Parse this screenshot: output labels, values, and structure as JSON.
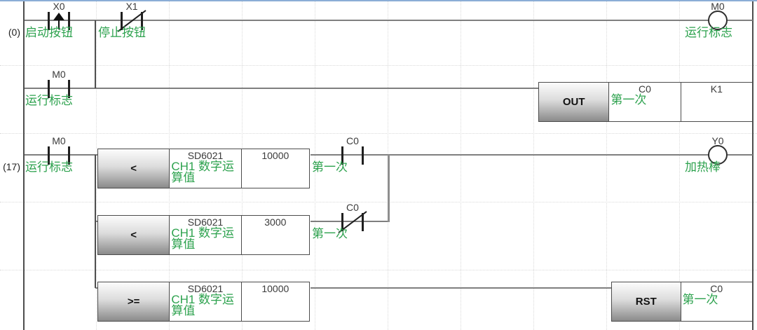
{
  "rung0": {
    "step_label": "(0)",
    "x0": {
      "device": "X0",
      "comment": "启动按钮"
    },
    "x1": {
      "device": "X1",
      "comment": "停止按钮"
    },
    "m0_coil": {
      "device": "M0",
      "comment": "运行标志"
    },
    "branch_m0": {
      "device": "M0",
      "comment": "运行标志"
    },
    "out_block": {
      "op": "OUT",
      "target": {
        "device": "C0",
        "comment": "第一次"
      },
      "value": {
        "device": "K1"
      }
    }
  },
  "rung17": {
    "step_label": "(17)",
    "m0": {
      "device": "M0",
      "comment": "运行标志"
    },
    "cmp1": {
      "op": "<",
      "s1": {
        "device": "SD6021",
        "comment": "CH1 数字运算值"
      },
      "s2": {
        "device": "10000"
      }
    },
    "c0": {
      "device": "C0",
      "comment": "第一次"
    },
    "y0_coil": {
      "device": "Y0",
      "comment": "加热棒"
    },
    "cmp2": {
      "op": "<",
      "s1": {
        "device": "SD6021",
        "comment": "CH1 数字运算值"
      },
      "s2": {
        "device": "3000"
      }
    },
    "c0_nc": {
      "device": "C0",
      "comment": "第一次"
    },
    "cmp3": {
      "op": ">=",
      "s1": {
        "device": "SD6021",
        "comment": "CH1 数字运算值"
      },
      "s2": {
        "device": "10000"
      }
    },
    "rst_block": {
      "op": "RST",
      "target": {
        "device": "C0",
        "comment": "第一次"
      }
    }
  },
  "colors": {
    "comment_green": "#2da24e",
    "device_text": "#3a3a3a",
    "wire_gray": "#7f7f7f",
    "selection_blue": "#8badd6"
  }
}
